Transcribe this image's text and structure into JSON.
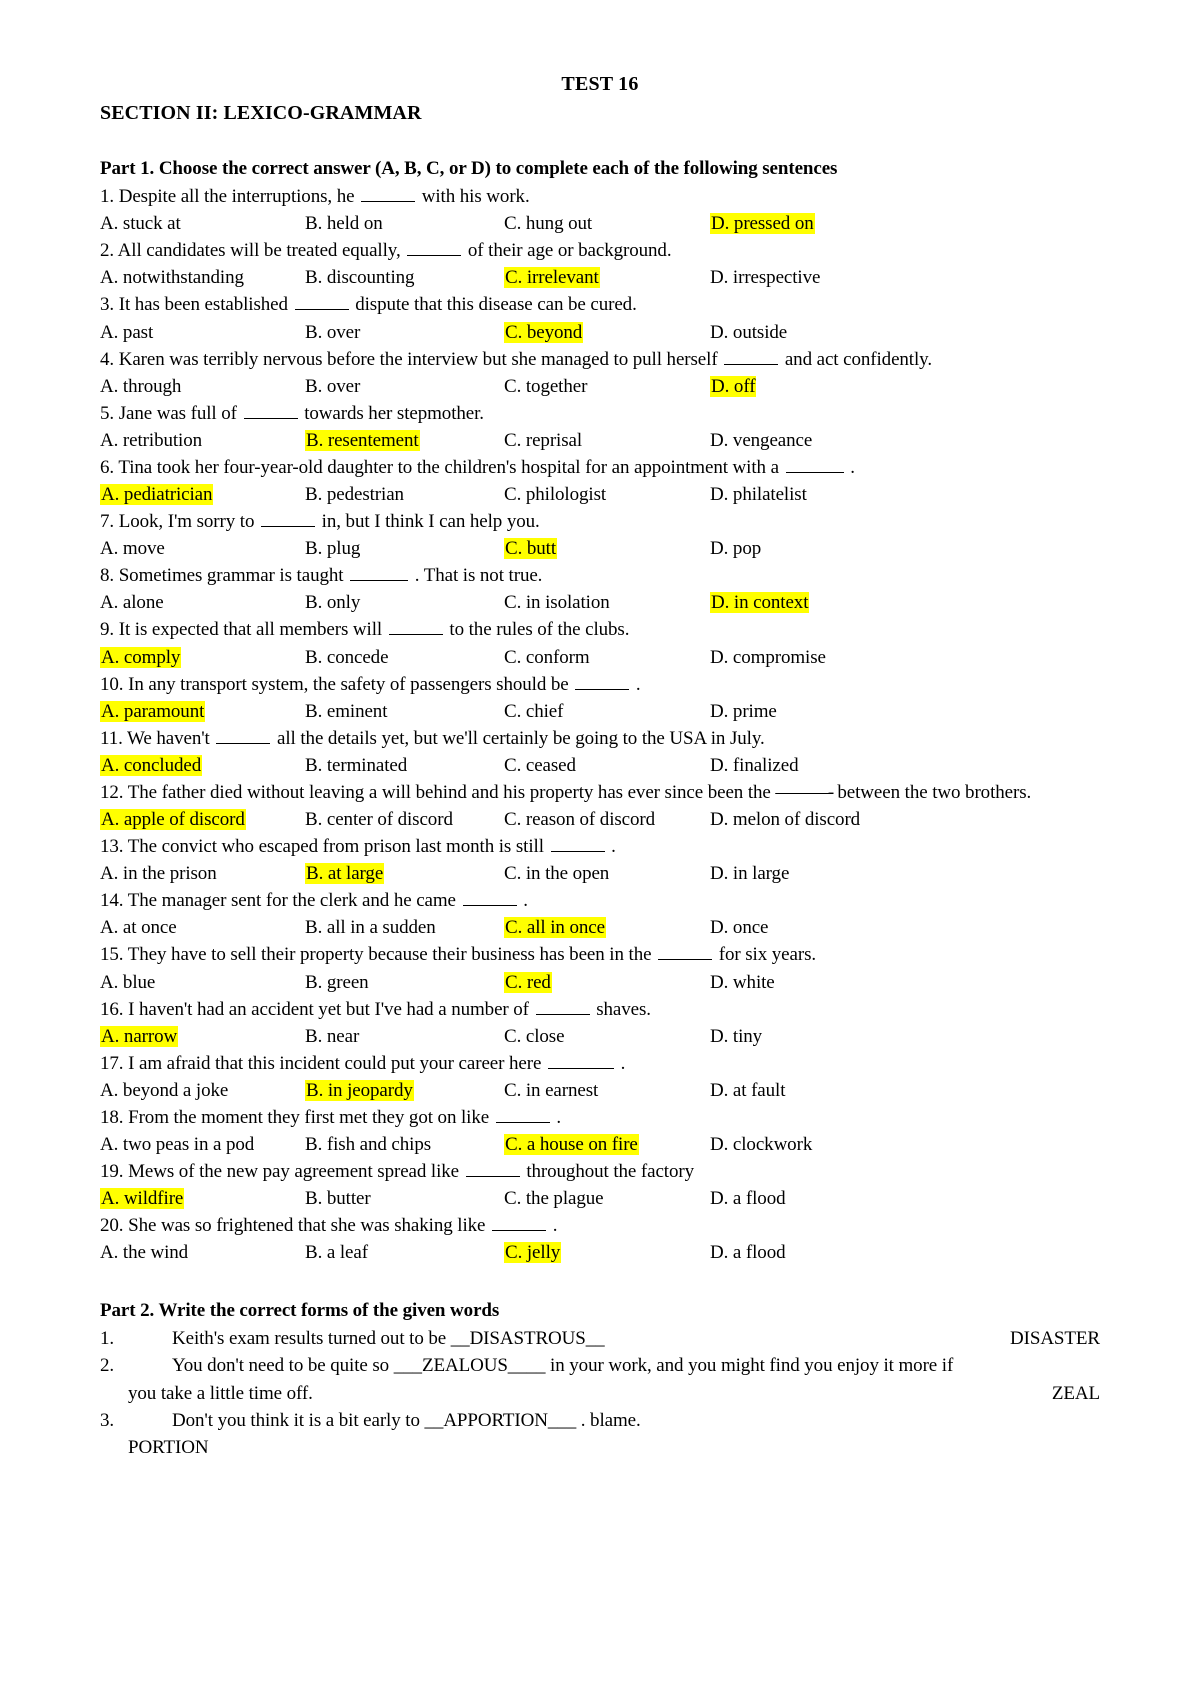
{
  "document": {
    "title": "TEST 16",
    "section_heading": "SECTION II: LEXICO-GRAMMAR"
  },
  "part1": {
    "heading": "Part 1. Choose the correct answer (A, B, C, or D) to complete each of the following sentences",
    "questions": [
      {
        "number": "1.",
        "stem_before": "Despite all the interruptions, he",
        "stem_after": "with his work.",
        "options": [
          {
            "label": "A. stuck at",
            "highlight": false
          },
          {
            "label": "B. held on",
            "highlight": false
          },
          {
            "label": "C. hung out",
            "highlight": false
          },
          {
            "label": "D. pressed on",
            "highlight": true
          }
        ]
      },
      {
        "number": "2.",
        "stem_before": "All candidates will be treated equally,",
        "stem_after": "of their age or background.",
        "options": [
          {
            "label": "A. notwithstanding",
            "highlight": false
          },
          {
            "label": "B. discounting",
            "highlight": false
          },
          {
            "label": "C. irrelevant",
            "highlight": true
          },
          {
            "label": "D. irrespective",
            "highlight": false
          }
        ]
      },
      {
        "number": "3.",
        "stem_before": "It has been established",
        "stem_after": "dispute that this disease can be cured.",
        "options": [
          {
            "label": "A. past",
            "highlight": false
          },
          {
            "label": "B. over",
            "highlight": false
          },
          {
            "label": "C. beyond",
            "highlight": true
          },
          {
            "label": "D. outside",
            "highlight": false
          }
        ]
      },
      {
        "number": "4.",
        "stem_before": "Karen was terribly nervous before the interview but she managed to pull herself",
        "stem_after": "and act confidently.",
        "options": [
          {
            "label": "A. through",
            "highlight": false
          },
          {
            "label": "B. over",
            "highlight": false
          },
          {
            "label": "C. together",
            "highlight": false
          },
          {
            "label": "D. off",
            "highlight": true
          }
        ]
      },
      {
        "number": "5.",
        "stem_before": "Jane was full of",
        "stem_after": "towards her stepmother.",
        "options": [
          {
            "label": "A. retribution",
            "highlight": false
          },
          {
            "label": "B. resentement",
            "highlight": true
          },
          {
            "label": "C. reprisal",
            "highlight": false
          },
          {
            "label": "D. vengeance",
            "highlight": false
          }
        ]
      },
      {
        "number": "6.",
        "stem_before": "Tina took her four-year-old daughter to the children's hospital for an appointment with a",
        "stem_after": ".",
        "options": [
          {
            "label": "A. pediatrician",
            "highlight": true
          },
          {
            "label": "B. pedestrian",
            "highlight": false
          },
          {
            "label": "C. philologist",
            "highlight": false
          },
          {
            "label": "D.  philatelist",
            "highlight": false
          }
        ]
      },
      {
        "number": "7.",
        "stem_before": "Look, I'm sorry to",
        "stem_after": "in, but I think I can help you.",
        "options": [
          {
            "label": "A. move",
            "highlight": false
          },
          {
            "label": "B. plug",
            "highlight": false
          },
          {
            "label": "C. butt",
            "highlight": true
          },
          {
            "label": "D. pop",
            "highlight": false
          }
        ]
      },
      {
        "number": "8.",
        "stem_before": "Sometimes grammar is taught",
        "stem_after": ". That is not true.",
        "options": [
          {
            "label": "A. alone",
            "highlight": false
          },
          {
            "label": "B. only",
            "highlight": false
          },
          {
            "label": "C. in isolation",
            "highlight": false
          },
          {
            "label": "D. in context",
            "highlight": true
          }
        ]
      },
      {
        "number": "9.",
        "stem_before": "It is expected that all members will",
        "stem_after": "to the rules of the clubs.",
        "options": [
          {
            "label": "A. comply",
            "highlight": true
          },
          {
            "label": "B. concede",
            "highlight": false
          },
          {
            "label": "C. conform",
            "highlight": false
          },
          {
            "label": "D. compromise",
            "highlight": false
          }
        ]
      },
      {
        "number": "10.",
        "stem_before": "In any transport system, the safety of passengers should be",
        "stem_after": ".",
        "options": [
          {
            "label": "A. paramount",
            "highlight": true
          },
          {
            "label": "B. eminent",
            "highlight": false
          },
          {
            "label": "C. chief",
            "highlight": false
          },
          {
            "label": "D. prime",
            "highlight": false
          }
        ]
      },
      {
        "number": "11.",
        "stem_before": "We haven't",
        "stem_after": "all the details yet, but we'll certainly be going to the USA in July.",
        "options": [
          {
            "label": "A. concluded",
            "highlight": true
          },
          {
            "label": "B. terminated",
            "highlight": false
          },
          {
            "label": "C. ceased",
            "highlight": false
          },
          {
            "label": "D. finalized",
            "highlight": false
          }
        ]
      },
      {
        "number": "12.",
        "stem_before": "The father died without leaving a will behind and his property has ever since been the",
        "stem_dash": "———-",
        "stem_after": "between the two brothers.",
        "options": [
          {
            "label": "A. apple of discord",
            "highlight": true
          },
          {
            "label": "B. center of discord",
            "highlight": false
          },
          {
            "label": "C. reason of discord",
            "highlight": false
          },
          {
            "label": "D. melon of discord",
            "highlight": false
          }
        ]
      },
      {
        "number": "13.",
        "stem_before": "The convict who escaped from prison last month is still",
        "stem_after": ".",
        "options": [
          {
            "label": "A.  in the prison",
            "highlight": false
          },
          {
            "label": "B.  at large",
            "highlight": true
          },
          {
            "label": "C. in the open",
            "highlight": false
          },
          {
            "label": "D. in large",
            "highlight": false
          }
        ]
      },
      {
        "number": "14.",
        "stem_before": " The manager sent for the clerk and he came",
        "stem_after": ".",
        "options": [
          {
            "label": "A.  at once",
            "highlight": false
          },
          {
            "label": "B. all in a sudden",
            "highlight": false
          },
          {
            "label": "C. all in once",
            "highlight": true
          },
          {
            "label": "D. once",
            "highlight": false
          }
        ]
      },
      {
        "number": "15.",
        "stem_before": "They have to sell their property because their business has been in the",
        "stem_after": "for six years.",
        "options": [
          {
            "label": "A. blue",
            "highlight": false
          },
          {
            "label": "B. green",
            "highlight": false
          },
          {
            "label": "C. red",
            "highlight": true
          },
          {
            "label": "D. white",
            "highlight": false
          }
        ]
      },
      {
        "number": "16.",
        "stem_before": "I haven't had an accident yet but I've had a number of",
        "stem_after": "shaves.",
        "options": [
          {
            "label": "A. narrow",
            "highlight": true
          },
          {
            "label": "B. near",
            "highlight": false
          },
          {
            "label": "C. close",
            "highlight": false
          },
          {
            "label": "D. tiny",
            "highlight": false
          }
        ]
      },
      {
        "number": "17.",
        "stem_before": "I am afraid that this incident could put your career here",
        "stem_after": ".",
        "options": [
          {
            "label": "A. beyond a joke",
            "highlight": false
          },
          {
            "label": "B. in jeopardy",
            "highlight": true
          },
          {
            "label": "C. in earnest",
            "highlight": false
          },
          {
            "label": "D. at fault",
            "highlight": false
          }
        ]
      },
      {
        "number": "18.",
        "stem_before": "From the moment they first met they got on like",
        "stem_after": ".",
        "options": [
          {
            "label": "A. two peas in a pod",
            "highlight": false
          },
          {
            "label": "B. fish and chips",
            "highlight": false
          },
          {
            "label": "C. a house on fire",
            "highlight": true
          },
          {
            "label": "D. clockwork",
            "highlight": false
          }
        ]
      },
      {
        "number": "19.",
        "stem_before": "Mews of the new pay agreement spread like",
        "stem_after": "throughout the factory",
        "options": [
          {
            "label": "A. wildfire",
            "highlight": true
          },
          {
            "label": "B. butter",
            "highlight": false
          },
          {
            "label": "C. the plague",
            "highlight": false
          },
          {
            "label": "D. a flood",
            "highlight": false
          }
        ]
      },
      {
        "number": "20.",
        "stem_before": "She was so frightened that she was shaking like",
        "stem_after": ".",
        "options": [
          {
            "label": "A. the wind",
            "highlight": false
          },
          {
            "label": "B. a leaf",
            "highlight": false
          },
          {
            "label": "C. jelly",
            "highlight": true
          },
          {
            "label": "D. a flood",
            "highlight": false
          }
        ]
      }
    ]
  },
  "part2": {
    "heading": "Part 2. Write the correct forms of the given words",
    "items": [
      {
        "number": "1.",
        "text_before": "Keith's exam results turned out to be",
        "answer": "__DISASTROUS__",
        "text_after": "",
        "cue": "DISASTER",
        "continuation": "",
        "continuation_cue": ""
      },
      {
        "number": "2.",
        "text_before": "You don't  need to be quite  so",
        "answer": "___ZEALOUS____",
        "text_after": "in your work, and you might find you enjoy it more if",
        "cue": "",
        "continuation": "you take a little time off.",
        "continuation_cue": "ZEAL"
      },
      {
        "number": "3.",
        "text_before": "Don't you think it is a bit early to",
        "answer": "__APPORTION___",
        "text_after": ". blame.",
        "cue": "",
        "continuation": "PORTION",
        "continuation_cue": ""
      }
    ]
  },
  "colors": {
    "highlight": "#ffff00",
    "text": "#000000",
    "background": "#ffffff"
  }
}
